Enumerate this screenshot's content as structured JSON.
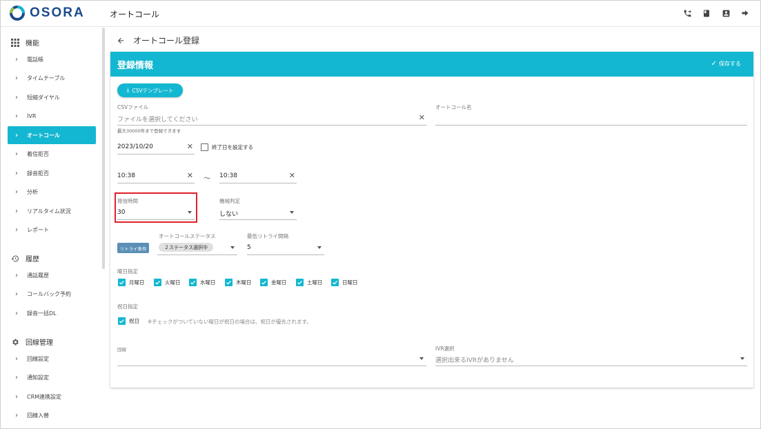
{
  "header": {
    "logo_text": "OSORA",
    "page_title": "オートコール",
    "icons": [
      "phone-forward-icon",
      "book-icon",
      "account-box-icon",
      "logout-arrow-icon"
    ]
  },
  "sidebar": {
    "sections": [
      {
        "title": "機能",
        "icon": "apps-grid-icon"
      },
      {
        "title": "履歴",
        "icon": "history-icon"
      },
      {
        "title": "回線管理",
        "icon": "gear-icon"
      }
    ],
    "features": [
      "電話帳",
      "タイムテーブル",
      "短縮ダイヤル",
      "IVR",
      "オートコール",
      "着信拒否",
      "録音拒否",
      "分析",
      "リアルタイム状況",
      "レポート"
    ],
    "history": [
      "通話履歴",
      "コールバック予約",
      "録音一括DL"
    ],
    "line_mgmt": [
      "回線設定",
      "通知設定",
      "CRM連携設定",
      "回線入替"
    ],
    "active": "オートコール"
  },
  "main": {
    "back_title": "オートコール登録",
    "card_title": "登録情報",
    "save_label": "保存する",
    "csv_template_label": "CSVテンプレート",
    "csv_file_label": "CSVファイル",
    "csv_file_placeholder": "ファイルを選択してください",
    "csv_file_hint": "最大30000件まで登録できます",
    "autocall_name_label": "オートコール名",
    "autocall_name_value": "",
    "start_date": "2023/10/20",
    "end_date_checkbox_label": "終了日を設定する",
    "end_date_checked": false,
    "time_from": "10:38",
    "time_separator": "～",
    "time_to": "10:38",
    "dial_time_label": "発信時間",
    "dial_time_value": "30",
    "machine_detect_label": "機械判定",
    "machine_detect_value": "しない",
    "retry_chip_label": "リトライ条件",
    "autocall_status_label": "オートコールステータス",
    "autocall_status_value": "２ステータス選択中",
    "min_retry_label": "最低リトライ間隔",
    "min_retry_value": "5",
    "weekday_label": "曜日指定",
    "weekdays": [
      {
        "label": "月曜日",
        "checked": true
      },
      {
        "label": "火曜日",
        "checked": true
      },
      {
        "label": "水曜日",
        "checked": true
      },
      {
        "label": "木曜日",
        "checked": true
      },
      {
        "label": "金曜日",
        "checked": true
      },
      {
        "label": "土曜日",
        "checked": true
      },
      {
        "label": "日曜日",
        "checked": true
      }
    ],
    "holiday_label": "祝日指定",
    "holiday_checkbox_label": "祝日",
    "holiday_checked": true,
    "holiday_note": "※チェックがついていない曜日が祝日の場合は、祝日が優先されます。",
    "line_label": "回線",
    "line_value": "",
    "ivr_label": "IVR選択",
    "ivr_placeholder": "選択出来るIVRがありません"
  },
  "colors": {
    "accent": "#13b7d1",
    "logo": "#1c4a8c",
    "retry_chip": "#5a8fb6",
    "highlight": "#e0202a"
  }
}
